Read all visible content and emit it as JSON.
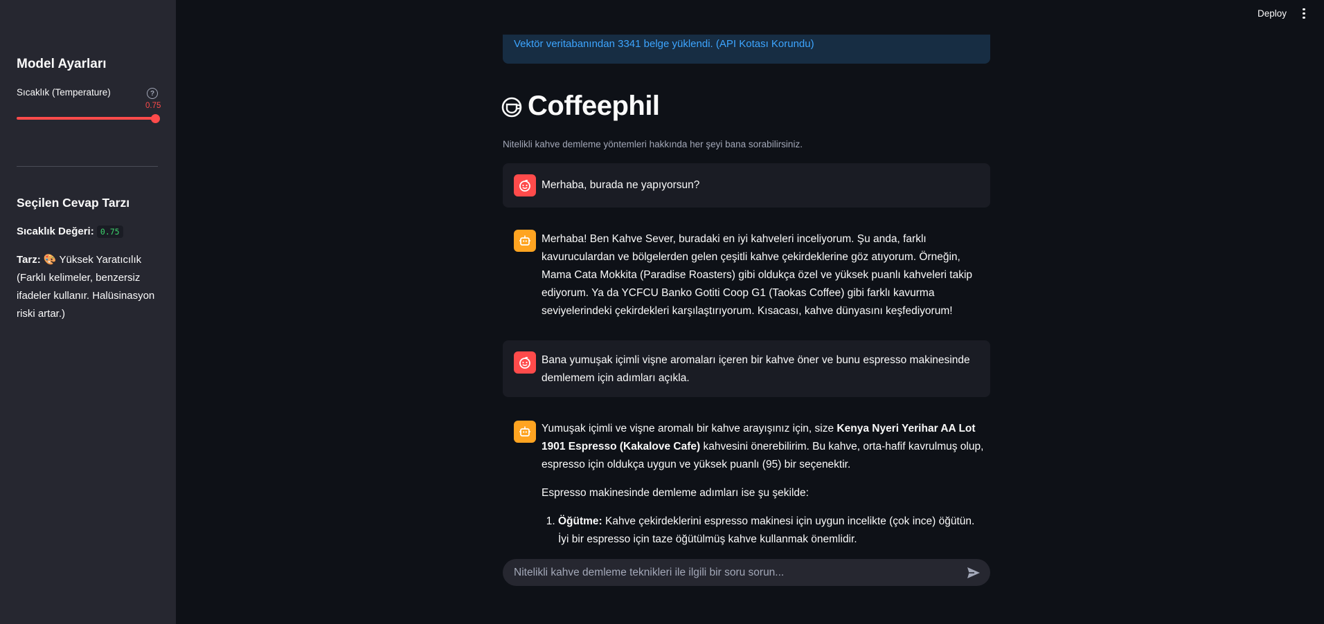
{
  "header": {
    "deploy_label": "Deploy"
  },
  "sidebar": {
    "settings_title": "Model Ayarları",
    "slider_label": "Sıcaklık (Temperature)",
    "slider_value": "0.75",
    "slider_fraction": 1.0,
    "style_title": "Seçilen Cevap Tarzı",
    "temp_label": "Sıcaklık Değeri:",
    "temp_value": "0.75",
    "style_label": "Tarz:",
    "style_emoji": "🎨",
    "style_text": "Yüksek Yaratıcılık (Farklı kelimeler, benzersiz ifadeler kullanır. Halüsinasyon riski artar.)"
  },
  "main": {
    "info_text": "Vektör veritabanından 3341 belge yüklendi. (API Kotası Korundu)",
    "title": "Coffeephil",
    "caption": "Nitelikli kahve demleme yöntemleri hakkında her şeyi bana sorabilirsiniz.",
    "messages": [
      {
        "text": "Merhaba, burada ne yapıyorsun?"
      },
      {
        "text": "Merhaba! Ben Kahve Sever, buradaki en iyi kahveleri inceliyorum. Şu anda, farklı kavuruculardan ve bölgelerden gelen çeşitli kahve çekirdeklerine göz atıyorum. Örneğin, Mama Cata Mokkita (Paradise Roasters) gibi oldukça özel ve yüksek puanlı kahveleri takip ediyorum. Ya da YCFCU Banko Gotiti Coop G1 (Taokas Coffee) gibi farklı kavurma seviyelerindeki çekirdekleri karşılaştırıyorum. Kısacası, kahve dünyasını keşfediyorum!"
      },
      {
        "text": "Bana yumuşak içimli vişne aromaları içeren bir kahve öner ve bunu espresso makinesinde demlemem için adımları açıkla."
      },
      {
        "intro": "Yumuşak içimli ve vişne aromalı bir kahve arayışınız için, size",
        "bold": "Kenya Nyeri Yerihar AA Lot 1901 Espresso (Kakalove Cafe)",
        "rest": "kahvesini önerebilirim. Bu kahve, orta-hafif kavrulmuş olup, espresso için oldukça uygun ve yüksek puanlı (95) bir seçenektir.",
        "para2": "Espresso makinesinde demleme adımları ise şu şekilde:",
        "step1_bold": "Öğütme:",
        "step1_text": "Kahve çekirdeklerini espresso makinesi için uygun incelikte (çok ince) öğütün. İyi bir espresso için taze öğütülmüş kahve kullanmak önemlidir."
      }
    ]
  },
  "chat_input": {
    "placeholder": "Nitelikli kahve demleme teknikleri ile ilgili bir soru sorun..."
  },
  "icons": {
    "title": "coffee-cup-icon",
    "user": "smiley-icon",
    "assistant": "robot-icon",
    "send": "send-icon",
    "help": "help-icon",
    "menu": "kebab-menu-icon"
  },
  "colors": {
    "accent": "#ff4b4b",
    "bot_avatar": "#ffa421",
    "info": "#3da5ff",
    "sidebar_bg": "#262730",
    "main_bg": "#0e1117"
  }
}
